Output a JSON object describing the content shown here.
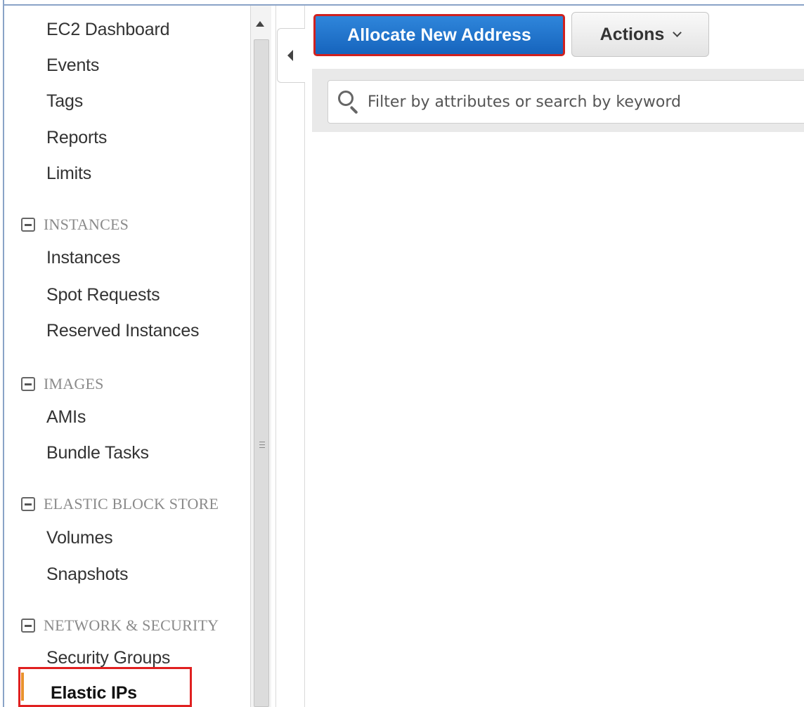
{
  "toolbar": {
    "allocate_label": "Allocate New Address",
    "actions_label": "Actions"
  },
  "search": {
    "placeholder": "Filter by attributes or search by keyword"
  },
  "sidebar": {
    "top_items": [
      "EC2 Dashboard",
      "Events",
      "Tags",
      "Reports",
      "Limits"
    ],
    "sections": [
      {
        "title": "INSTANCES",
        "items": [
          "Instances",
          "Spot Requests",
          "Reserved Instances"
        ]
      },
      {
        "title": "IMAGES",
        "items": [
          "AMIs",
          "Bundle Tasks"
        ]
      },
      {
        "title": "ELASTIC BLOCK STORE",
        "items": [
          "Volumes",
          "Snapshots"
        ]
      },
      {
        "title": "NETWORK & SECURITY",
        "items": [
          "Security Groups",
          "Elastic IPs"
        ]
      }
    ],
    "active_item": "Elastic IPs"
  },
  "colors": {
    "primary_button": "#1f72cc",
    "highlight_border": "#e02020",
    "active_indicator": "#e9922d"
  }
}
